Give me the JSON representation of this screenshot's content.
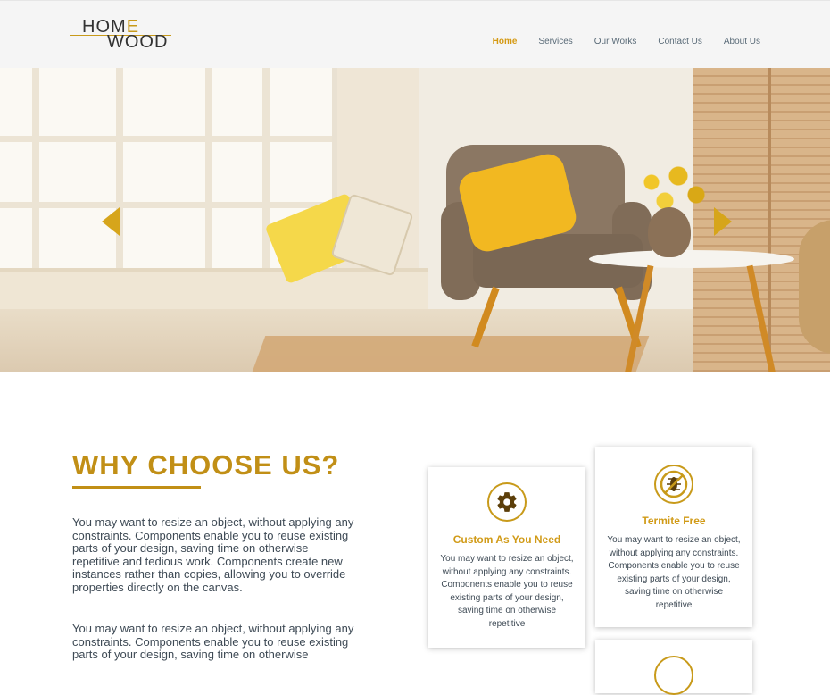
{
  "header": {
    "logo": {
      "line1": "HOME",
      "line2": "WOOD"
    },
    "nav": [
      {
        "label": "Home",
        "active": true
      },
      {
        "label": "Services",
        "active": false
      },
      {
        "label": "Our Works",
        "active": false
      },
      {
        "label": "Contact Us",
        "active": false
      },
      {
        "label": "About Us",
        "active": false
      }
    ]
  },
  "hero": {
    "prev_icon": "chevron-left-icon",
    "next_icon": "chevron-right-icon"
  },
  "why": {
    "title": "WHY CHOOSE US?",
    "paragraph1": "You may want to resize an object, without applying any constraints. Components enable you to reuse existing parts of your design, saving time on otherwise repetitive and tedious work. Components create new instances rather than copies, allowing you to override properties directly on the canvas.",
    "paragraph2": "You may want to resize an object, without applying any constraints. Components enable you to reuse existing parts of your design, saving time on otherwise"
  },
  "cards": [
    {
      "icon": "gear-icon",
      "title": "Custom As You Need",
      "text": "You may want to resize an object, without applying any constraints. Components enable you to reuse existing parts of your design, saving time on otherwise repetitive"
    },
    {
      "icon": "no-termite-icon",
      "title": "Termite Free",
      "text": "You may want to resize an object, without applying any constraints. Components enable you to reuse existing parts of your design, saving time on otherwise repetitive"
    },
    {
      "icon": "feature-icon",
      "title": "",
      "text": ""
    }
  ],
  "colors": {
    "accent": "#c89a1a",
    "text": "#3e4a55",
    "nav": "#5a6b78"
  }
}
